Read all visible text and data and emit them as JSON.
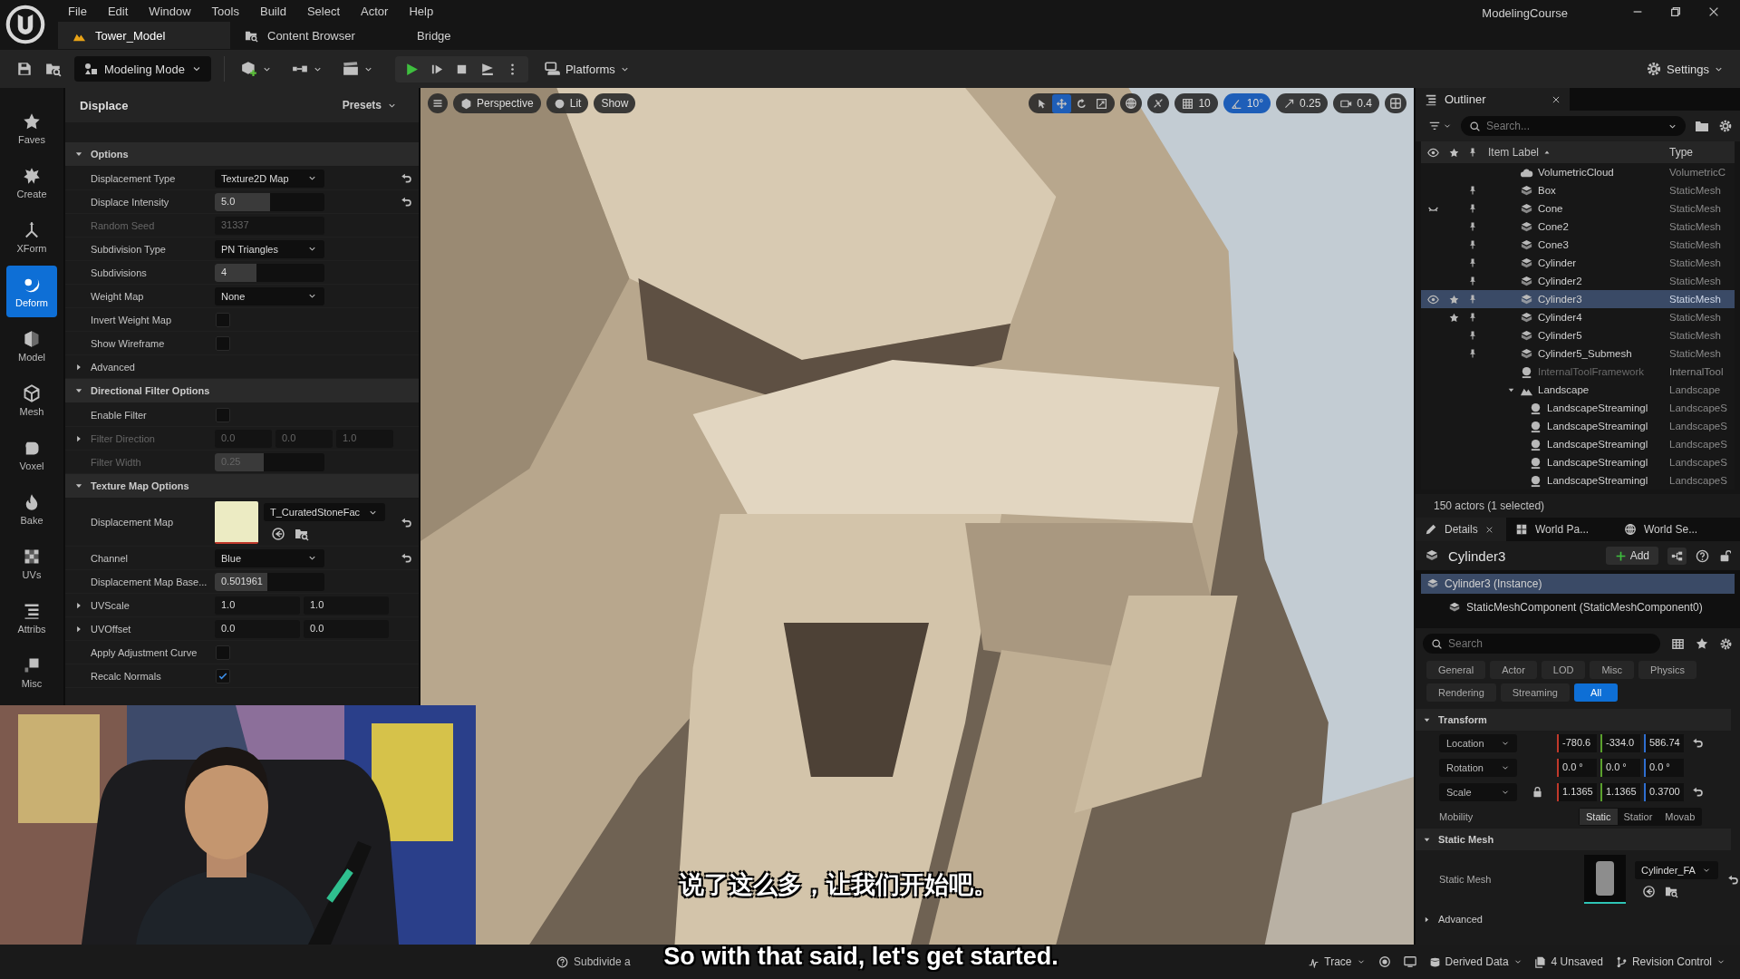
{
  "window": {
    "menu": [
      "File",
      "Edit",
      "Window",
      "Tools",
      "Build",
      "Select",
      "Actor",
      "Help"
    ],
    "project": "ModelingCourse"
  },
  "title_tabs": [
    {
      "label": "Tower_Model",
      "selected": true
    },
    {
      "label": "Content Browser",
      "selected": false
    },
    {
      "label": "Bridge",
      "selected": false
    }
  ],
  "toolbar": {
    "mode": "Modeling Mode",
    "platforms": "Platforms",
    "settings": "Settings"
  },
  "tool_sidebar": [
    {
      "label": "Faves",
      "selected": false
    },
    {
      "label": "Create",
      "selected": false
    },
    {
      "label": "XForm",
      "selected": false
    },
    {
      "label": "Deform",
      "selected": true
    },
    {
      "label": "Model",
      "selected": false
    },
    {
      "label": "Mesh",
      "selected": false
    },
    {
      "label": "Voxel",
      "selected": false
    },
    {
      "label": "Bake",
      "selected": false
    },
    {
      "label": "UVs",
      "selected": false
    },
    {
      "label": "Attribs",
      "selected": false
    },
    {
      "label": "Misc",
      "selected": false
    }
  ],
  "panel": {
    "title": "Displace",
    "presets": "Presets",
    "sections": [
      {
        "title": "Options",
        "expanded": true,
        "rows": [
          {
            "kind": "dropdown",
            "label": "Displacement Type",
            "value": "Texture2D Map",
            "reset": true,
            "disabled": false
          },
          {
            "kind": "slider",
            "label": "Displace Intensity",
            "value": "5.0",
            "level": 0.5,
            "reset": true,
            "disabled": false
          },
          {
            "kind": "number",
            "label": "Random Seed",
            "value": "31337",
            "reset": false,
            "disabled": true
          },
          {
            "kind": "dropdown",
            "label": "Subdivision Type",
            "value": "PN Triangles",
            "reset": false,
            "disabled": false
          },
          {
            "kind": "slider",
            "label": "Subdivisions",
            "value": "4",
            "level": 0.38,
            "reset": false,
            "disabled": false
          },
          {
            "kind": "dropdown",
            "label": "Weight Map",
            "value": "None",
            "reset": false,
            "disabled": false
          },
          {
            "kind": "checkbox",
            "label": "Invert Weight Map",
            "checked": false,
            "reset": false,
            "disabled": false
          },
          {
            "kind": "checkbox",
            "label": "Show Wireframe",
            "checked": false,
            "reset": false,
            "disabled": false
          },
          {
            "kind": "group",
            "label": "Advanced",
            "expanded": false
          }
        ]
      },
      {
        "title": "Directional Filter Options",
        "expanded": true,
        "rows": [
          {
            "kind": "checkbox",
            "label": "Enable Filter",
            "checked": false,
            "reset": false,
            "disabled": false
          },
          {
            "kind": "vector",
            "label": "Filter Direction",
            "values": [
              "0.0",
              "0.0",
              "1.0"
            ],
            "reset": false,
            "disabled": true
          },
          {
            "kind": "slider",
            "label": "Filter Width",
            "value": "0.25",
            "level": 0.45,
            "reset": false,
            "disabled": true
          }
        ]
      },
      {
        "title": "Texture Map Options",
        "expanded": true,
        "rows": [
          {
            "kind": "asset",
            "label": "Displacement Map",
            "value": "T_CuratedStoneFac",
            "reset": true,
            "disabled": false
          },
          {
            "kind": "dropdown",
            "label": "Channel",
            "value": "Blue",
            "reset": true,
            "disabled": false
          },
          {
            "kind": "slider",
            "label": "Displacement Map Base...",
            "value": "0.501961",
            "level": 0.48,
            "reset": false,
            "disabled": false
          },
          {
            "kind": "vector",
            "label": "UVScale",
            "values": [
              "1.0",
              "1.0"
            ],
            "reset": false,
            "disabled": false
          },
          {
            "kind": "vector",
            "label": "UVOffset",
            "values": [
              "0.0",
              "0.0"
            ],
            "reset": false,
            "disabled": false
          },
          {
            "kind": "checkbox",
            "label": "Apply Adjustment Curve",
            "checked": false,
            "reset": false,
            "disabled": false
          },
          {
            "kind": "checkbox",
            "label": "Recalc Normals",
            "checked": true,
            "reset": false,
            "disabled": false
          }
        ]
      }
    ]
  },
  "viewport": {
    "view": "Perspective",
    "lighting": "Lit",
    "show": "Show",
    "transform_tools": [
      {
        "kind": "select",
        "selected": false
      },
      {
        "kind": "move",
        "selected": true
      },
      {
        "kind": "rotate",
        "selected": false
      },
      {
        "kind": "scale",
        "selected": false
      }
    ],
    "snaps": [
      {
        "kind": "grid",
        "value": "10",
        "on": false
      },
      {
        "kind": "angle",
        "value": "10°",
        "on": true
      },
      {
        "kind": "scale",
        "value": "0.25",
        "on": false
      },
      {
        "kind": "camera",
        "value": "0.4",
        "on": false
      }
    ]
  },
  "outliner": {
    "title": "Outliner",
    "search": {
      "placeholder": "Search..."
    },
    "columns": [
      "Item Label",
      "Type"
    ],
    "items": [
      {
        "kind": "cloud",
        "label": "VolumetricCloud",
        "type": "VolumetricC",
        "hidden": false,
        "starred": false,
        "pinned": false,
        "selected": false,
        "dimmed": false
      },
      {
        "kind": "mesh",
        "label": "Box",
        "type": "StaticMesh",
        "hidden": false,
        "starred": false,
        "pinned": true,
        "selected": false,
        "dimmed": false
      },
      {
        "kind": "mesh",
        "label": "Cone",
        "type": "StaticMesh",
        "hidden": true,
        "starred": false,
        "pinned": true,
        "selected": false,
        "dimmed": false
      },
      {
        "kind": "mesh",
        "label": "Cone2",
        "type": "StaticMesh",
        "hidden": false,
        "starred": false,
        "pinned": true,
        "selected": false,
        "dimmed": false
      },
      {
        "kind": "mesh",
        "label": "Cone3",
        "type": "StaticMesh",
        "hidden": false,
        "starred": false,
        "pinned": true,
        "selected": false,
        "dimmed": false
      },
      {
        "kind": "mesh",
        "label": "Cylinder",
        "type": "StaticMesh",
        "hidden": false,
        "starred": false,
        "pinned": true,
        "selected": false,
        "dimmed": false
      },
      {
        "kind": "mesh",
        "label": "Cylinder2",
        "type": "StaticMesh",
        "hidden": false,
        "starred": false,
        "pinned": true,
        "selected": false,
        "dimmed": false
      },
      {
        "kind": "mesh",
        "label": "Cylinder3",
        "type": "StaticMesh",
        "hidden": false,
        "starred": true,
        "pinned": true,
        "selected": true,
        "dimmed": false
      },
      {
        "kind": "mesh",
        "label": "Cylinder4",
        "type": "StaticMesh",
        "hidden": false,
        "starred": true,
        "pinned": true,
        "selected": false,
        "dimmed": false
      },
      {
        "kind": "mesh",
        "label": "Cylinder5",
        "type": "StaticMesh",
        "hidden": false,
        "starred": false,
        "pinned": true,
        "selected": false,
        "dimmed": false
      },
      {
        "kind": "mesh",
        "label": "Cylinder5_Submesh",
        "type": "StaticMesh",
        "hidden": false,
        "starred": false,
        "pinned": true,
        "selected": false,
        "dimmed": false
      },
      {
        "kind": "tool",
        "label": "InternalToolFramework",
        "type": "InternalTool",
        "hidden": false,
        "starred": false,
        "pinned": false,
        "selected": false,
        "dimmed": true
      },
      {
        "kind": "landscape",
        "label": "Landscape",
        "type": "Landscape",
        "hidden": false,
        "starred": false,
        "pinned": false,
        "selected": false,
        "dimmed": false,
        "expanded": true,
        "children": [
          {
            "kind": "tool",
            "label": "LandscapeStreamingl",
            "type": "LandscapeS",
            "hidden": false,
            "starred": false,
            "pinned": false,
            "selected": false,
            "dimmed": false
          },
          {
            "kind": "tool",
            "label": "LandscapeStreamingl",
            "type": "LandscapeS",
            "hidden": false,
            "starred": false,
            "pinned": false,
            "selected": false,
            "dimmed": false
          },
          {
            "kind": "tool",
            "label": "LandscapeStreamingl",
            "type": "LandscapeS",
            "hidden": false,
            "starred": false,
            "pinned": false,
            "selected": false,
            "dimmed": false
          },
          {
            "kind": "tool",
            "label": "LandscapeStreamingl",
            "type": "LandscapeS",
            "hidden": false,
            "starred": false,
            "pinned": false,
            "selected": false,
            "dimmed": false
          },
          {
            "kind": "tool",
            "label": "LandscapeStreamingl",
            "type": "LandscapeS",
            "hidden": false,
            "starred": false,
            "pinned": false,
            "selected": false,
            "dimmed": false
          }
        ]
      }
    ],
    "footer": "150 actors (1 selected)"
  },
  "details": {
    "tabs": [
      {
        "label": "Details",
        "selected": true
      },
      {
        "label": "World Pa...",
        "selected": false
      },
      {
        "label": "World Se...",
        "selected": false
      }
    ],
    "actor": "Cylinder3",
    "add": "Add",
    "components": [
      {
        "label": "Cylinder3 (Instance)",
        "selected": true,
        "children": [
          {
            "label": "StaticMeshComponent (StaticMeshComponent0)",
            "selected": false
          }
        ]
      }
    ],
    "search": {
      "placeholder": "Search"
    },
    "filters": [
      {
        "label": "General",
        "selected": false
      },
      {
        "label": "Actor",
        "selected": false
      },
      {
        "label": "LOD",
        "selected": false
      },
      {
        "label": "Misc",
        "selected": false
      },
      {
        "label": "Physics",
        "selected": false
      },
      {
        "label": "Rendering",
        "selected": false
      },
      {
        "label": "Streaming",
        "selected": false
      },
      {
        "label": "All",
        "selected": true
      }
    ],
    "transform": {
      "title": "Transform",
      "rows": [
        {
          "label": "Location",
          "values": [
            "-780.6",
            "-334.0",
            "586.74"
          ],
          "reset": true,
          "lock": false
        },
        {
          "label": "Rotation",
          "values": [
            "0.0 °",
            "0.0 °",
            "0.0 °"
          ],
          "reset": false,
          "lock": false
        },
        {
          "label": "Scale",
          "values": [
            "1.1365",
            "1.1365",
            "0.3700"
          ],
          "reset": true,
          "lock": true
        }
      ],
      "mobility": {
        "label": "Mobility",
        "options": [
          {
            "label": "Static",
            "selected": true
          },
          {
            "label": "Statior",
            "selected": false
          },
          {
            "label": "Movab",
            "selected": false
          }
        ]
      }
    },
    "static_mesh": {
      "title": "Static Mesh",
      "label": "Static Mesh",
      "asset": "Cylinder_FA",
      "advanced": "Advanced"
    }
  },
  "status_bar": {
    "hint": "Subdivide a",
    "trace": "Trace",
    "derived_data": "Derived Data",
    "unsaved": "4 Unsaved",
    "revision": "Revision Control"
  },
  "subtitles": [
    "说了这么多，让我们开始吧。",
    "So with that said, let's get started."
  ]
}
